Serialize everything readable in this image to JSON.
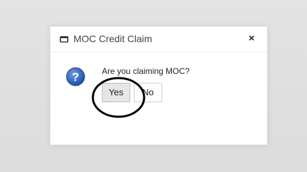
{
  "dialog": {
    "title": "MOC Credit Claim",
    "close_label": "×",
    "message": "Are you claiming MOC?",
    "yes_label": "Yes",
    "no_label": "No",
    "title_icon": "window-icon",
    "message_icon": "question-icon"
  },
  "colors": {
    "background": "#e0e0e0",
    "dialog_bg": "#ffffff",
    "question_icon": "#2f64b5",
    "annotation": "#000000"
  }
}
